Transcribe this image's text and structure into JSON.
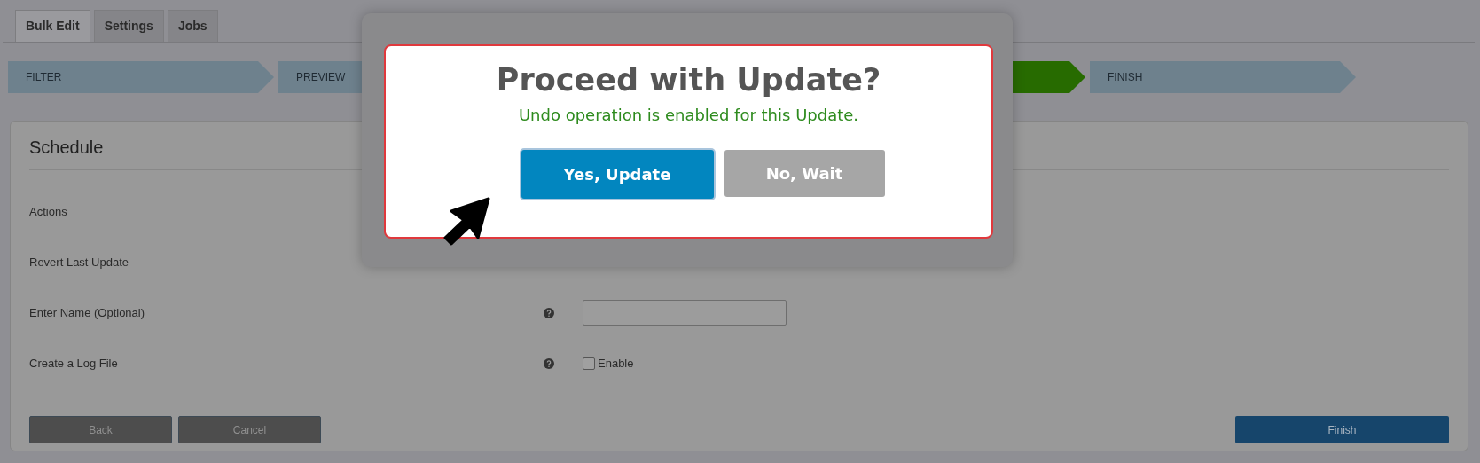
{
  "tabs": [
    {
      "label": "Bulk Edit",
      "selected": true
    },
    {
      "label": "Settings",
      "selected": false
    },
    {
      "label": "Jobs",
      "selected": false
    }
  ],
  "steps": [
    {
      "label": "FILTER",
      "selected": false
    },
    {
      "label": "PREVIEW",
      "selected": false
    },
    {
      "selected": true
    },
    {
      "label": "FINISH",
      "selected": false
    }
  ],
  "schedule": {
    "title": "Schedule",
    "rows": [
      {
        "kind": "plain",
        "label": "Actions"
      },
      {
        "kind": "plain",
        "label": "Revert Last Update"
      },
      {
        "kind": "text",
        "label": "Enter Name (Optional)"
      },
      {
        "kind": "checkbox",
        "label": "Create a Log File",
        "option": "Enable",
        "checked": false
      }
    ],
    "buttons": [
      "Back",
      "Cancel"
    ],
    "primary_button": "Finish"
  },
  "dialog": {
    "title": "Proceed with Update?",
    "message": "Undo operation is enabled for this Update.",
    "confirm": "Yes, Update",
    "cancel": "No, Wait"
  }
}
